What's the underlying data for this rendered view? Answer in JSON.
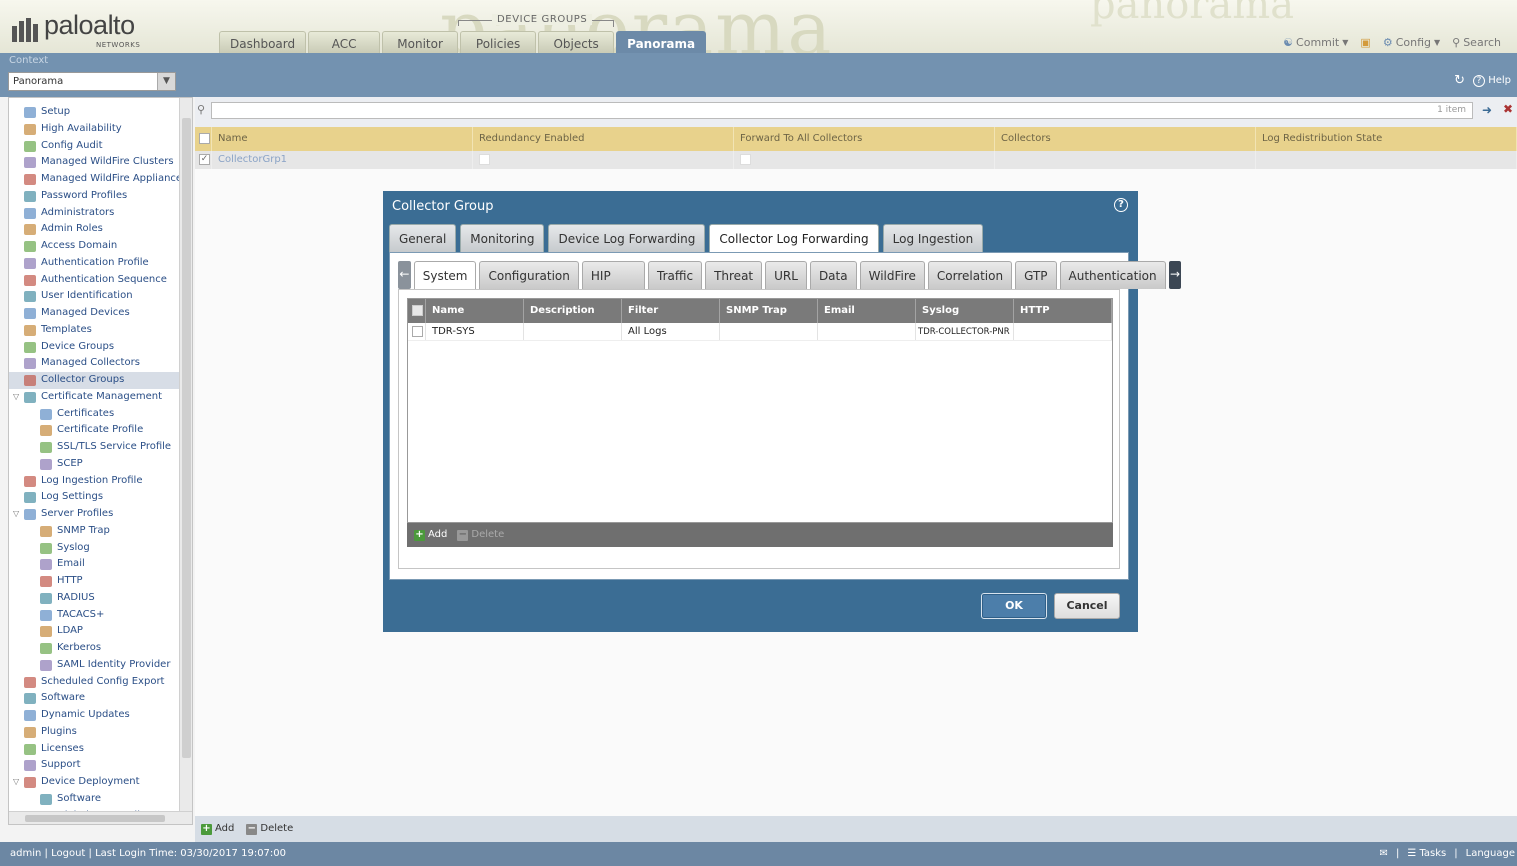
{
  "header": {
    "logo_text": "paloalto",
    "logo_sub": "NETWORKS",
    "bg_word": "panorama",
    "device_groups_label": "DEVICE GROUPS",
    "tabs": [
      "Dashboard",
      "ACC",
      "Monitor",
      "Policies",
      "Objects",
      "Panorama"
    ],
    "active_tab": "Panorama",
    "commit_label": "Commit",
    "config_label": "Config",
    "search_label": "Search"
  },
  "context": {
    "label": "Context",
    "value": "Panorama",
    "help_label": "Help"
  },
  "sidebar": {
    "items": [
      {
        "label": "Setup",
        "level": 0,
        "icon": "setup-icon"
      },
      {
        "label": "High Availability",
        "level": 0,
        "icon": "ha-icon"
      },
      {
        "label": "Config Audit",
        "level": 0,
        "icon": "audit-icon"
      },
      {
        "label": "Managed WildFire Clusters",
        "level": 0,
        "icon": "wildfire-icon"
      },
      {
        "label": "Managed WildFire Appliances",
        "level": 0,
        "icon": "wildfire-icon"
      },
      {
        "label": "Password Profiles",
        "level": 0,
        "icon": "password-icon"
      },
      {
        "label": "Administrators",
        "level": 0,
        "icon": "admin-icon"
      },
      {
        "label": "Admin Roles",
        "level": 0,
        "icon": "roles-icon"
      },
      {
        "label": "Access Domain",
        "level": 0,
        "icon": "domain-icon"
      },
      {
        "label": "Authentication Profile",
        "level": 0,
        "icon": "auth-icon"
      },
      {
        "label": "Authentication Sequence",
        "level": 0,
        "icon": "auth-seq-icon"
      },
      {
        "label": "User Identification",
        "level": 0,
        "icon": "user-id-icon"
      },
      {
        "label": "Managed Devices",
        "level": 0,
        "icon": "devices-icon"
      },
      {
        "label": "Templates",
        "level": 0,
        "icon": "templates-icon"
      },
      {
        "label": "Device Groups",
        "level": 0,
        "icon": "folder-icon"
      },
      {
        "label": "Managed Collectors",
        "level": 0,
        "icon": "collector-icon"
      },
      {
        "label": "Collector Groups",
        "level": 0,
        "icon": "folder-icon",
        "selected": true
      },
      {
        "label": "Certificate Management",
        "level": 0,
        "icon": "cert-mgmt-icon",
        "expanded": true
      },
      {
        "label": "Certificates",
        "level": 1,
        "icon": "cert-icon"
      },
      {
        "label": "Certificate Profile",
        "level": 1,
        "icon": "cert-icon"
      },
      {
        "label": "SSL/TLS Service Profile",
        "level": 1,
        "icon": "lock-icon"
      },
      {
        "label": "SCEP",
        "level": 1,
        "icon": "cert-icon"
      },
      {
        "label": "Log Ingestion Profile",
        "level": 0,
        "icon": "log-icon"
      },
      {
        "label": "Log Settings",
        "level": 0,
        "icon": "log-icon"
      },
      {
        "label": "Server Profiles",
        "level": 0,
        "icon": "server-icon",
        "expanded": true
      },
      {
        "label": "SNMP Trap",
        "level": 1,
        "icon": "server-icon"
      },
      {
        "label": "Syslog",
        "level": 1,
        "icon": "server-icon"
      },
      {
        "label": "Email",
        "level": 1,
        "icon": "server-icon"
      },
      {
        "label": "HTTP",
        "level": 1,
        "icon": "server-icon"
      },
      {
        "label": "RADIUS",
        "level": 1,
        "icon": "server-icon"
      },
      {
        "label": "TACACS+",
        "level": 1,
        "icon": "server-icon"
      },
      {
        "label": "LDAP",
        "level": 1,
        "icon": "server-icon"
      },
      {
        "label": "Kerberos",
        "level": 1,
        "icon": "server-icon"
      },
      {
        "label": "SAML Identity Provider",
        "level": 1,
        "icon": "server-icon"
      },
      {
        "label": "Scheduled Config Export",
        "level": 0,
        "icon": "export-icon"
      },
      {
        "label": "Software",
        "level": 0,
        "icon": "software-icon"
      },
      {
        "label": "Dynamic Updates",
        "level": 0,
        "icon": "updates-icon"
      },
      {
        "label": "Plugins",
        "level": 0,
        "icon": "plugins-icon"
      },
      {
        "label": "Licenses",
        "level": 0,
        "icon": "key-icon"
      },
      {
        "label": "Support",
        "level": 0,
        "icon": "support-icon"
      },
      {
        "label": "Device Deployment",
        "level": 0,
        "icon": "deploy-icon",
        "expanded": true
      },
      {
        "label": "Software",
        "level": 1,
        "icon": "software-icon"
      },
      {
        "label": "GlobalProtect Client",
        "level": 1,
        "icon": "globe-icon"
      }
    ]
  },
  "main": {
    "item_count": "1 item",
    "columns": [
      "Name",
      "Redundancy Enabled",
      "Forward To All Collectors",
      "Collectors",
      "Log Redistribution State"
    ],
    "rows": [
      [
        "CollectorGrp1",
        "",
        "",
        "",
        ""
      ]
    ],
    "add_label": "Add",
    "delete_label": "Delete"
  },
  "dialog": {
    "title": "Collector Group",
    "tabs": [
      "General",
      "Monitoring",
      "Device Log Forwarding",
      "Collector Log Forwarding",
      "Log Ingestion"
    ],
    "active_tab": "Collector Log Forwarding",
    "subtabs": [
      "System",
      "Configuration",
      "HIP Match",
      "Traffic",
      "Threat",
      "URL",
      "Data",
      "WildFire",
      "Correlation",
      "GTP",
      "Authentication"
    ],
    "active_subtab": "System",
    "grid_columns": [
      "Name",
      "Description",
      "Filter",
      "SNMP Trap",
      "Email",
      "Syslog",
      "HTTP"
    ],
    "grid_rows": [
      [
        "TDR-SYS",
        "",
        "All Logs",
        "",
        "",
        "TDR-COLLECTOR-PNR",
        ""
      ]
    ],
    "add_label": "Add",
    "delete_label": "Delete",
    "ok_label": "OK",
    "cancel_label": "Cancel"
  },
  "status": {
    "user": "admin",
    "logout": "Logout",
    "last_login": "Last Login Time: 03/30/2017 19:07:00",
    "tasks": "Tasks",
    "language": "Language"
  }
}
